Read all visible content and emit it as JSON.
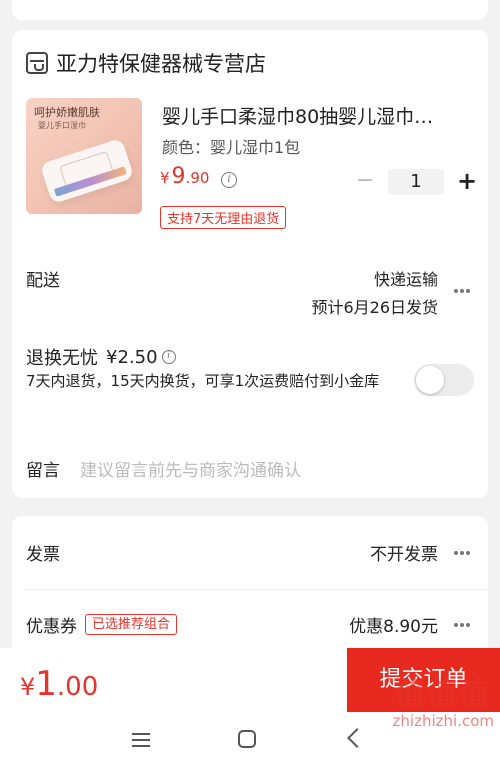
{
  "shop": {
    "name": "亚力特保健器械专营店",
    "icon": "store-icon"
  },
  "product": {
    "thumb_caption": "呵护娇嫩肌肤",
    "thumb_sub": "婴儿手口湿巾",
    "title": "婴儿手口柔湿巾80抽婴儿湿巾…",
    "spec": "颜色：婴儿湿巾1包",
    "price_symbol": "¥",
    "price_int": "9",
    "price_dec": ".90",
    "quantity": "1",
    "minus": "−",
    "plus": "+",
    "return_tag": "支持7天无理由退货"
  },
  "shipping": {
    "label": "配送",
    "method": "快递运输",
    "eta": "预计6月26日发货"
  },
  "insurance": {
    "title": "退换无忧",
    "price": "¥2.50",
    "desc": "7天内退货，15天内换货，可享1次运费赔付到小金库",
    "enabled": false
  },
  "message": {
    "label": "留言",
    "placeholder": "建议留言前先与商家沟通确认"
  },
  "invoice": {
    "label": "发票",
    "value": "不开发票"
  },
  "coupon": {
    "label": "优惠券",
    "tag": "已选推荐组合",
    "value": "优惠8.90元"
  },
  "footer": {
    "total_symbol": "¥",
    "total_int": "1",
    "total_dec": ".00",
    "submit_label": "提交订单"
  },
  "watermark": {
    "logo": "值值值",
    "text": "zhizhizhi.com"
  },
  "colors": {
    "accent": "#e5342b",
    "submit_bg": "#e8291f"
  }
}
